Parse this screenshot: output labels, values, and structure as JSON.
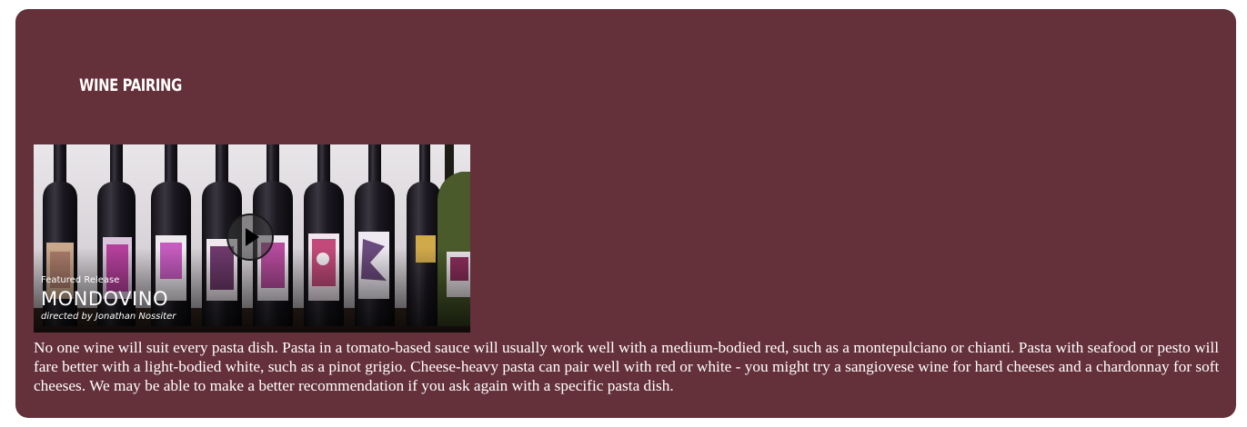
{
  "section": {
    "title": "WINE PAIRING"
  },
  "video": {
    "kicker": "Featured Release",
    "title": "MONDOVINO",
    "credit": "directed by Jonathan Nossiter",
    "play_icon": "play-icon"
  },
  "answer": {
    "text": "No one wine will suit every pasta dish. Pasta in a tomato-based sauce will usually work well with a medium-bodied red, such as a montepulciano or chianti. Pasta with seafood or pesto will fare better with a light-bodied white, such as a pinot grigio. Cheese-heavy pasta can pair well with red or white - you might try a sangiovese wine for hard cheeses and a chardonnay for soft cheeses. We may be able to make a better recommendation if you ask again with a specific pasta dish."
  },
  "colors": {
    "card_background": "#64303a",
    "text": "#ffffff"
  }
}
